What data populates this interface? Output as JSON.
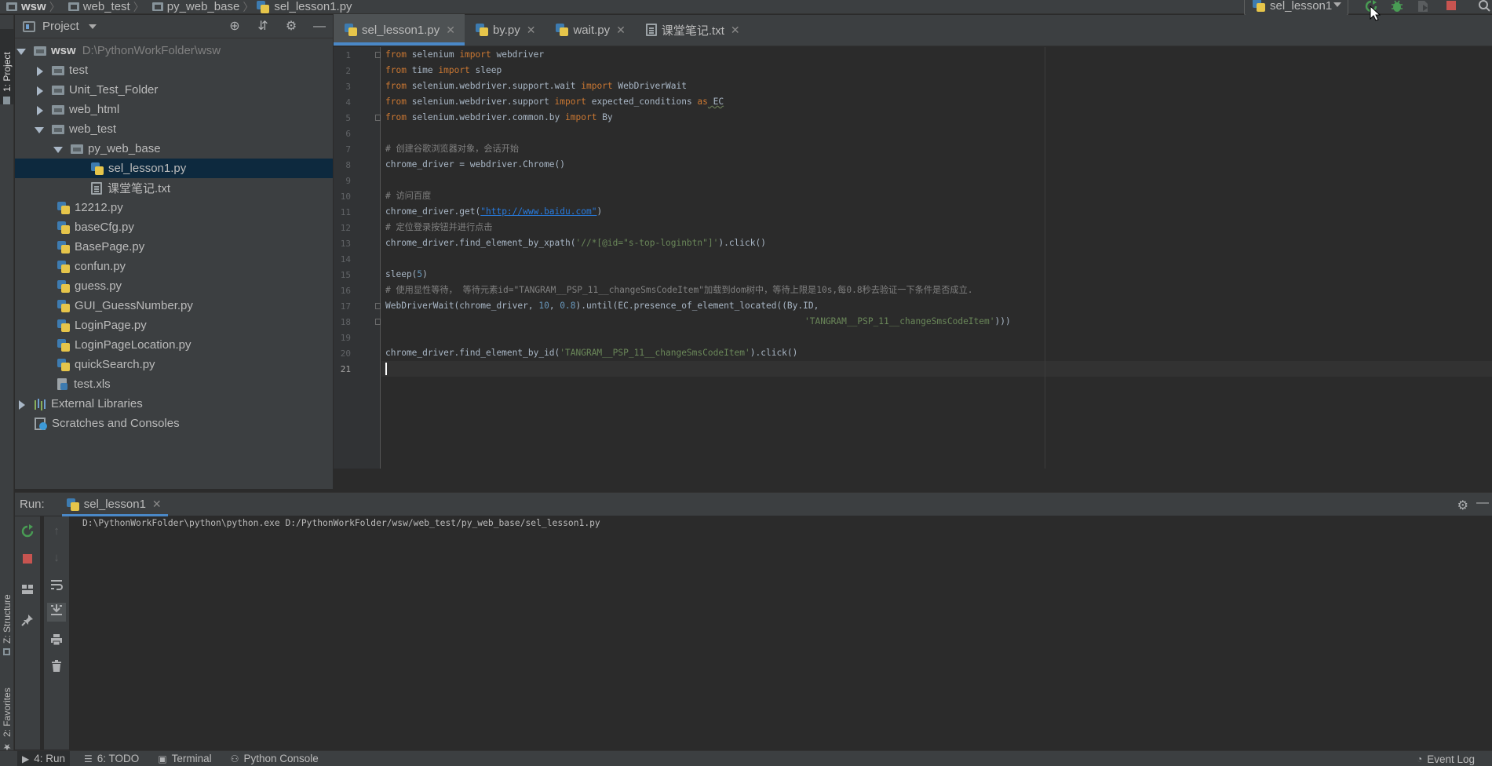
{
  "breadcrumb": [
    "wsw",
    "web_test",
    "py_web_base",
    "sel_lesson1.py"
  ],
  "toolbar": {
    "run_config": "sel_lesson1",
    "rerun_icon": "rerun-icon",
    "debug_icon": "debug-icon",
    "coverage_icon": "coverage-icon",
    "stop_icon": "stop-icon",
    "search_icon": "search-icon",
    "accent_green": "#499c54",
    "stop_red": "#c75450"
  },
  "left_strip": {
    "project_tab": "1: Project",
    "structure_tab": "Z: Structure",
    "favorites_tab": "2: Favorites"
  },
  "project": {
    "title": "Project",
    "root_name": "wsw",
    "root_path": "D:\\PythonWorkFolder\\wsw",
    "items": [
      "test",
      "Unit_Test_Folder",
      "web_html",
      "web_test",
      "py_web_base",
      "sel_lesson1.py",
      "课堂笔记.txt",
      "12212.py",
      "baseCfg.py",
      "BasePage.py",
      "confun.py",
      "guess.py",
      "GUI_GuessNumber.py",
      "LoginPage.py",
      "LoginPageLocation.py",
      "quickSearch.py",
      "test.xls",
      "External Libraries",
      "Scratches and Consoles"
    ]
  },
  "tabs": [
    {
      "label": "sel_lesson1.py",
      "active": true
    },
    {
      "label": "by.py",
      "active": false
    },
    {
      "label": "wait.py",
      "active": false
    },
    {
      "label": "课堂笔记.txt",
      "active": false
    }
  ],
  "editor": {
    "line_numbers": [
      "1",
      "2",
      "3",
      "4",
      "5",
      "6",
      "7",
      "8",
      "9",
      "10",
      "11",
      "12",
      "13",
      "14",
      "15",
      "16",
      "17",
      "18",
      "19",
      "20",
      "21"
    ],
    "lines": {
      "l1": {
        "kw1": "from",
        "a": " selenium ",
        "kw2": "import",
        "b": " webdriver"
      },
      "l2": {
        "kw1": "from",
        "a": " time ",
        "kw2": "import",
        "b": " sleep"
      },
      "l3": {
        "kw1": "from",
        "a": " selenium.webdriver.support.wait ",
        "kw2": "import",
        "b": " WebDriverWait"
      },
      "l4": {
        "kw1": "from",
        "a": " selenium.webdriver.support ",
        "kw2": "import",
        "b": " expected_conditions ",
        "kw3": "as",
        "c": " EC"
      },
      "l5": {
        "kw1": "from",
        "a": " selenium.webdriver.common.by ",
        "kw2": "import",
        "b": " By"
      },
      "l7": "# 创建谷歌浏览器对象，会话开始",
      "l8": "chrome_driver = webdriver.Chrome()",
      "l10": "# 访问百度",
      "l11": {
        "a": "chrome_driver.get(",
        "s": "\"http://www.baidu.com\"",
        "b": ")"
      },
      "l12": "# 定位登录按钮并进行点击",
      "l13": {
        "a": "chrome_driver.find_element_by_xpath(",
        "s": "'//*[@id=\"s-top-loginbtn\"]'",
        "b": ").click()"
      },
      "l15": {
        "a": "sleep(",
        "n": "5",
        "b": ")"
      },
      "l16": "# 使用显性等待， 等待元素id=\"TANGRAM__PSP_11__changeSmsCodeItem\"加载到dom树中，等待上限是10s,每0.8秒去验证一下条件是否成立.",
      "l17": {
        "a": "WebDriverWait(chrome_driver, ",
        "n1": "10",
        "b": ", ",
        "n2": "0.8",
        "c": ").until(EC.presence_of_element_located((By.ID,"
      },
      "l18": {
        "s": "'TANGRAM__PSP_11__changeSmsCodeItem'",
        "b": ")))"
      },
      "l20": {
        "a": "chrome_driver.find_element_by_id(",
        "s": "'TANGRAM__PSP_11__changeSmsCodeItem'",
        "b": ").click()"
      }
    }
  },
  "run": {
    "label": "Run:",
    "tab": "sel_lesson1",
    "output": "D:\\PythonWorkFolder\\python\\python.exe D:/PythonWorkFolder/wsw/web_test/py_web_base/sel_lesson1.py"
  },
  "statusbar": {
    "run": "4: Run",
    "todo": "6: TODO",
    "terminal": "Terminal",
    "python_console": "Python Console",
    "event_log": "Event Log"
  }
}
